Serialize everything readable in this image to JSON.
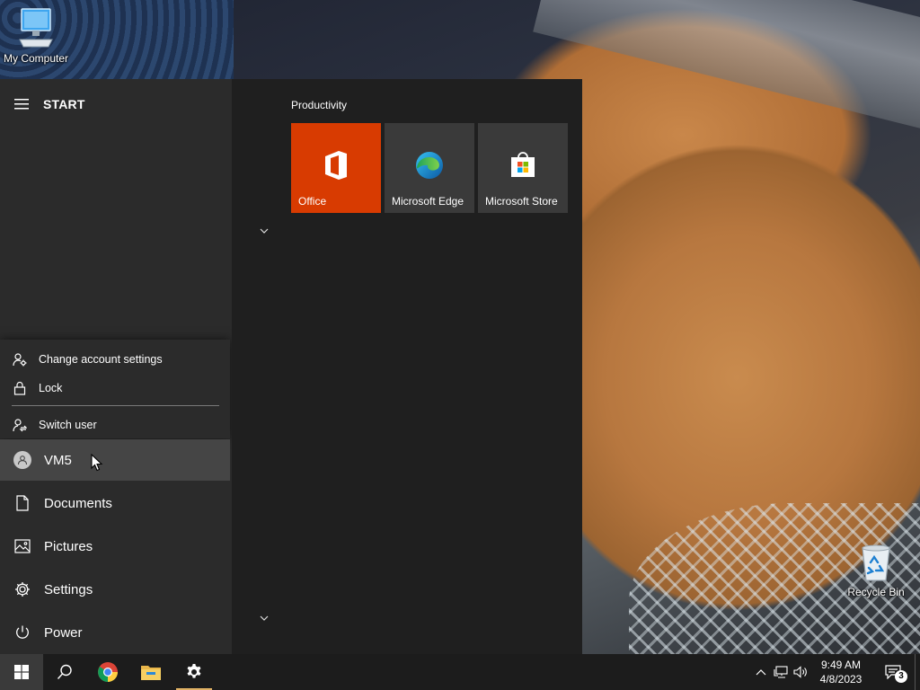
{
  "desktop": {
    "icons": [
      {
        "label": "My Computer",
        "icon": "computer-icon"
      },
      {
        "label": "Recycle Bin",
        "icon": "recycle-bin-icon"
      }
    ]
  },
  "start_menu": {
    "header_label": "START",
    "account_flyout": {
      "change_account": "Change account settings",
      "lock": "Lock",
      "switch_user": "Switch user"
    },
    "user_name": "VM5",
    "nav": {
      "documents": "Documents",
      "pictures": "Pictures",
      "settings": "Settings",
      "power": "Power"
    },
    "tile_group": "Productivity",
    "tiles": [
      {
        "label": "Office",
        "color": "#d83b01"
      },
      {
        "label": "Microsoft Edge",
        "color": "#3a3a3a"
      },
      {
        "label": "Microsoft Store",
        "color": "#3a3a3a"
      }
    ]
  },
  "taskbar": {
    "apps": [
      "start-icon",
      "search-icon",
      "chrome-icon",
      "file-explorer-icon",
      "settings-icon"
    ],
    "clock_time": "9:49 AM",
    "clock_date": "4/8/2023",
    "notification_count": "3"
  }
}
